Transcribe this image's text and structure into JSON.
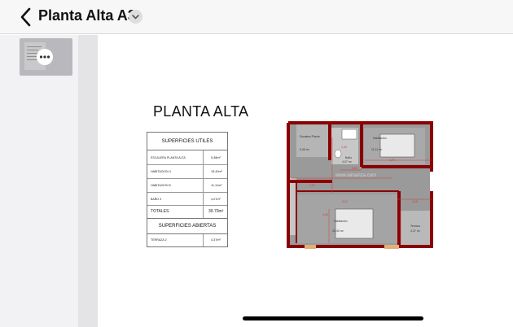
{
  "header": {
    "title": "Planta Alta A3"
  },
  "document": {
    "heading": "PLANTA ALTA",
    "table": {
      "useful_header": "SUPERFICIES UTILES",
      "rows": [
        {
          "label": "ESCALERA PLANTA ALTA",
          "value": "5,38m²"
        },
        {
          "label": "HABITACION 4",
          "value": "15,40m²"
        },
        {
          "label": "HABITACION 5",
          "value": "11,11m²"
        },
        {
          "label": "BAÑO 3",
          "value": "4,07m²"
        }
      ],
      "totals_label": "TOTALES",
      "totals_value": "39.70m²",
      "open_header": "SUPERFICIES ABIERTAS",
      "open_rows": [
        {
          "label": "TERRAZA 2",
          "value": "4,37m²"
        }
      ]
    },
    "plan": {
      "rooms": [
        {
          "name": "Escalera Planta",
          "area": "5,38 m²"
        },
        {
          "name": "Baño",
          "area": "4,07 m²"
        },
        {
          "name": "Habitación",
          "area": "11,11 m²"
        },
        {
          "name": "Habitación",
          "area": "15,40 m²"
        },
        {
          "name": "Terraza",
          "area": "4,37 m²"
        }
      ],
      "dims": [
        "1,44",
        "3,70",
        "3,62",
        "5,12",
        "1,67",
        "3,49",
        "4,00"
      ],
      "watermark": "www.lamanza.com"
    }
  },
  "colors": {
    "wall": "#8b0000",
    "dim": "#d23a3a",
    "accent": "#c0392b"
  }
}
